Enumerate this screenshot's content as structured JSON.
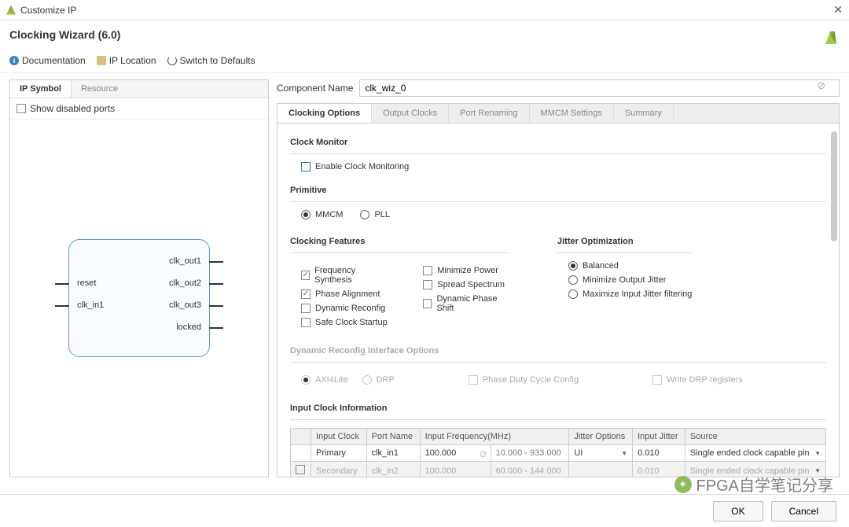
{
  "window": {
    "title": "Customize IP"
  },
  "header": {
    "title": "Clocking Wizard (6.0)"
  },
  "toolbar": {
    "doc": "Documentation",
    "iploc": "IP Location",
    "switch": "Switch to Defaults"
  },
  "left": {
    "tabs": {
      "symbol": "IP Symbol",
      "resource": "Resource"
    },
    "show_disabled": "Show disabled ports",
    "ports": {
      "reset": "reset",
      "clk_in1": "clk_in1",
      "clk_out1": "clk_out1",
      "clk_out2": "clk_out2",
      "clk_out3": "clk_out3",
      "locked": "locked"
    }
  },
  "comp": {
    "label": "Component Name",
    "value": "clk_wiz_0"
  },
  "tabs": {
    "t1": "Clocking Options",
    "t2": "Output Clocks",
    "t3": "Port Renaming",
    "t4": "MMCM Settings",
    "t5": "Summary"
  },
  "sec": {
    "clock_monitor": "Clock Monitor",
    "enable_cm": "Enable Clock Monitoring",
    "primitive": "Primitive",
    "mmcm": "MMCM",
    "pll": "PLL",
    "clk_feat": "Clocking Features",
    "jitter_opt": "Jitter Optimization",
    "freq_syn": "Frequency Synthesis",
    "min_power": "Minimize Power",
    "phase_align": "Phase Alignment",
    "spread": "Spread Spectrum",
    "dyn_recfg": "Dynamic Reconfig",
    "dyn_phase": "Dynamic Phase Shift",
    "safe_clk": "Safe Clock Startup",
    "balanced": "Balanced",
    "min_out_jit": "Minimize Output Jitter",
    "max_in_jit": "Maximize Input Jitter filtering",
    "dyn_recfg_if": "Dynamic Reconfig Interface Options",
    "axi4": "AXI4Lite",
    "drp": "DRP",
    "phase_duty": "Phase Duty Cycle Config",
    "write_drp": "Write DRP registers",
    "input_clk_info": "Input Clock Information"
  },
  "table": {
    "h1": "Input Clock",
    "h2": "Port Name",
    "h3": "Input Frequency(MHz)",
    "h4": "Jitter Options",
    "h5": "Input Jitter",
    "h6": "Source",
    "r1": {
      "name": "Primary",
      "port": "clk_in1",
      "freq": "100.000",
      "range": "10.000 - 933.000",
      "jitopt": "UI",
      "jitter": "0.010",
      "src": "Single ended clock capable pin"
    },
    "r2": {
      "name": "Secondary",
      "port": "clk_in2",
      "freq": "100.000",
      "range": "60.000 - 144.000",
      "jitopt": "",
      "jitter": "0.010",
      "src": "Single ended clock capable pin"
    }
  },
  "footer": {
    "ok": "OK",
    "cancel": "Cancel"
  },
  "watermark": "FPGA自学笔记分享"
}
